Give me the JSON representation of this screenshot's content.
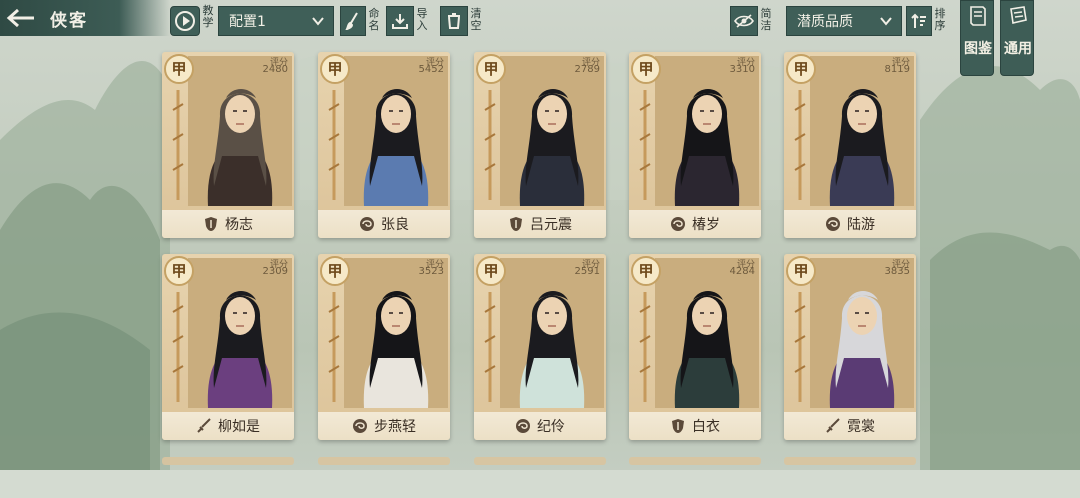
{
  "header": {
    "title": "侠客",
    "tutorial_label": "教学",
    "config_value": "配置1",
    "rename_label": "命名",
    "import_label": "导入",
    "clear_label": "清空",
    "simple_label": "简洁",
    "quality_value": "潜质品质",
    "sort_label": "排序",
    "gallery_label": "图鉴",
    "general_label": "通用"
  },
  "score_label": "评分",
  "rank_label": "甲",
  "cards": [
    {
      "name": "杨志",
      "score": "2480",
      "sect_icon": "shield-icon"
    },
    {
      "name": "张良",
      "score": "5452",
      "sect_icon": "swirl-icon"
    },
    {
      "name": "吕元震",
      "score": "2789",
      "sect_icon": "shield-icon"
    },
    {
      "name": "椿岁",
      "score": "3310",
      "sect_icon": "swirl-icon"
    },
    {
      "name": "陆游",
      "score": "8119",
      "sect_icon": "swirl-icon"
    },
    {
      "name": "柳如是",
      "score": "2309",
      "sect_icon": "sword-icon"
    },
    {
      "name": "步燕轻",
      "score": "3523",
      "sect_icon": "swirl-icon"
    },
    {
      "name": "纪伶",
      "score": "2591",
      "sect_icon": "swirl-icon"
    },
    {
      "name": "白衣",
      "score": "4284",
      "sect_icon": "shield-icon"
    },
    {
      "name": "霓裳",
      "score": "3835",
      "sect_icon": "sword-icon"
    }
  ],
  "colors": {
    "panel": "#3f5f58",
    "card": "#e2cca3",
    "rank_text": "#6e4a1c"
  }
}
